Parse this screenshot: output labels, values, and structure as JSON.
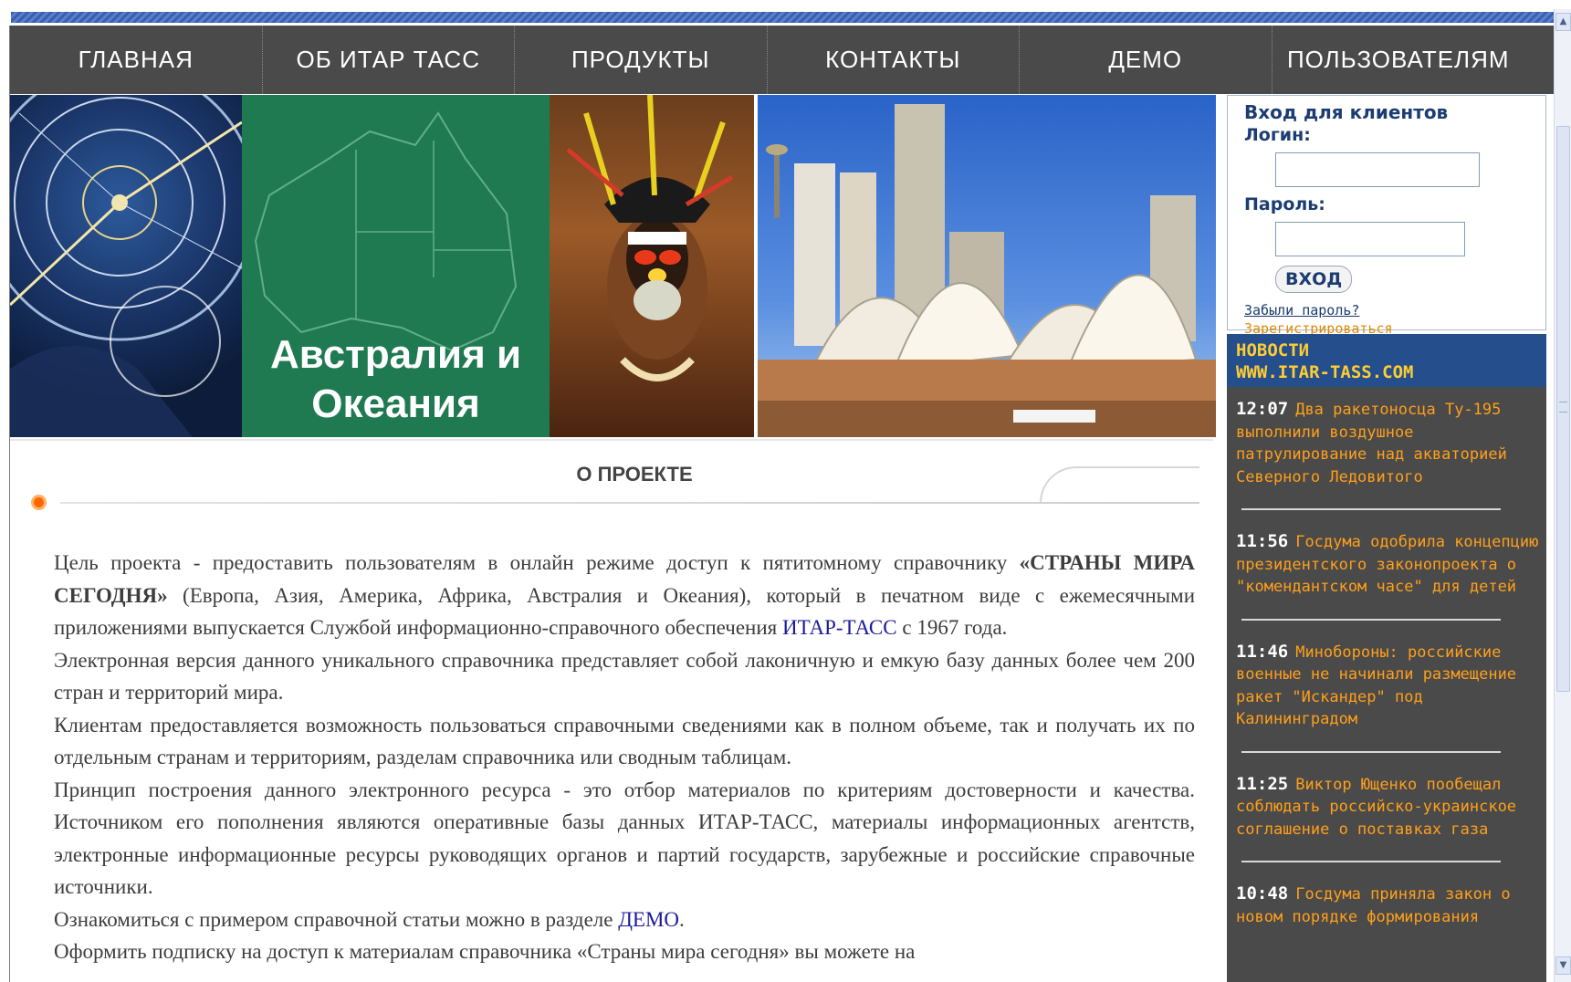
{
  "nav": {
    "items": [
      "ГЛАВНАЯ",
      "ОБ ИТАР ТАСС",
      "ПРОДУКТЫ",
      "КОНТАКТЫ",
      "ДЕМО",
      "ПОЛЬЗОВАТЕЛЯМ"
    ]
  },
  "banner": {
    "title_line1": "Австралия и",
    "title_line2": "Океания"
  },
  "login": {
    "title": "Вход для клиентов",
    "login_label": "Логин:",
    "password_label": "Пароль:",
    "login_value": "",
    "password_value": "",
    "submit_label": "ВХОД",
    "forgot_link": "Забыли пароль?",
    "register_link": "Зарегистрироваться"
  },
  "news": {
    "header_line1": "НОВОСТИ",
    "header_line2": "WWW.ITAR-TASS.COM",
    "items": [
      {
        "time": "12:07",
        "text": "Два ракетоносца Ту-195 выполнили воздушное патрулирование над акваторией Северного Ледовитого"
      },
      {
        "time": "11:56",
        "text": "Госдума одобрила концепцию президентского законопроекта о \"комендантском часе\" для детей"
      },
      {
        "time": "11:46",
        "text": "Минобороны: российские военные не начинали размещение ракет \"Искандер\" под Калининградом"
      },
      {
        "time": "11:25",
        "text": "Виктор Ющенко пообещал соблюдать российско-украинское соглашение о поставках газа"
      },
      {
        "time": "10:48",
        "text": "Госдума приняла закон о новом порядке формирования"
      }
    ]
  },
  "about": {
    "title": "О ПРОЕКТЕ",
    "p1_a": "Цель проекта - предоставить пользователям в онлайн режиме доступ к пятитомному справочнику ",
    "p1_bold": "«СТРАНЫ МИРА СЕГОДНЯ»",
    "p1_b": " (Европа, Азия, Америка, Африка, Австралия и Океания), который в печатном виде с ежемесячными приложениями выпускается Службой информационно-справочного обеспечения ",
    "p1_link": "ИТАР-ТАСС",
    "p1_c": " с 1967 года.",
    "p2": "Электронная версия данного уникального справочника представляет собой лаконичную и емкую базу данных более чем 200 стран и территорий мира.",
    "p3": "Клиентам предоставляется возможность пользоваться справочными сведениями как в полном объеме, так и получать их по отдельным странам и территориям, разделам справочника или сводным таблицам.",
    "p4": "Принцип построения данного электронного ресурса - это отбор материалов по критериям достоверности и качества. Источником его пополнения являются оперативные базы данных ИТАР-ТАСС, материалы информационных агентств, электронные информационные ресурсы руководящих органов и партий государств, зарубежные и российские справочные источники.",
    "p5_a": "Ознакомиться с примером справочной статьи можно в разделе ",
    "p5_link": "ДЕМО",
    "p5_b": ".",
    "p6": "Оформить подписку на доступ к материалам справочника «Страны мира сегодня» вы можете на"
  }
}
